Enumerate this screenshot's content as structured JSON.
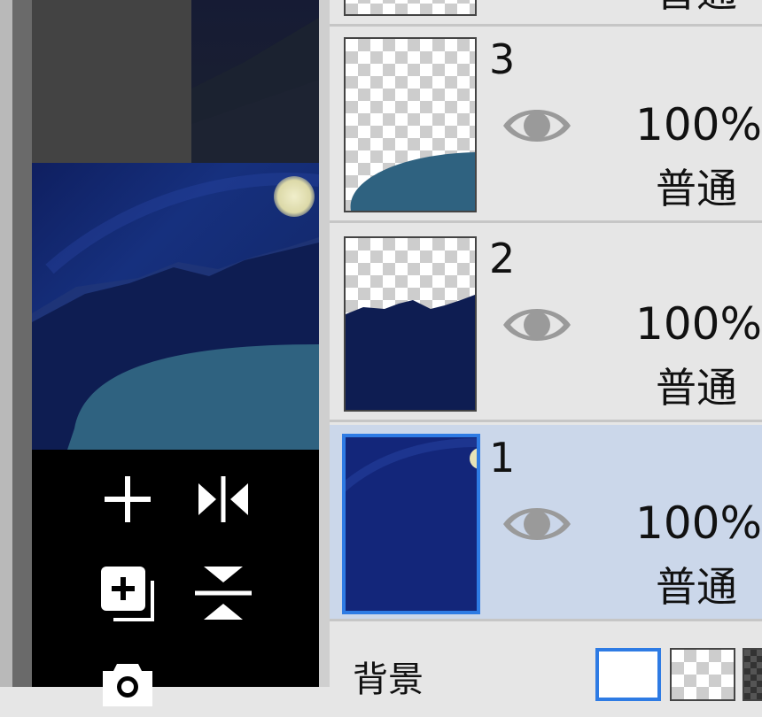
{
  "colors": {
    "accent": "#2e7be4",
    "selected_row": "#cbd7ea",
    "night_sky": "#13267a",
    "mountain": "#0e1d52",
    "lake": "#2f6280",
    "moon": "#e6e3b8"
  },
  "layers": [
    {
      "number": "3",
      "opacity": "100%",
      "blend": "普通",
      "visible": true,
      "selected": false
    },
    {
      "number": "2",
      "opacity": "100%",
      "blend": "普通",
      "visible": true,
      "selected": false
    },
    {
      "number": "1",
      "opacity": "100%",
      "blend": "普通",
      "visible": true,
      "selected": true
    }
  ],
  "top_partial": {
    "blend": "普通"
  },
  "background": {
    "label": "背景"
  },
  "tools": [
    {
      "icon": "plus-icon"
    },
    {
      "icon": "flip-horizontal-icon"
    },
    {
      "icon": "duplicate-layer-icon"
    },
    {
      "icon": "merge-down-icon"
    },
    {
      "icon": "camera-icon"
    }
  ]
}
